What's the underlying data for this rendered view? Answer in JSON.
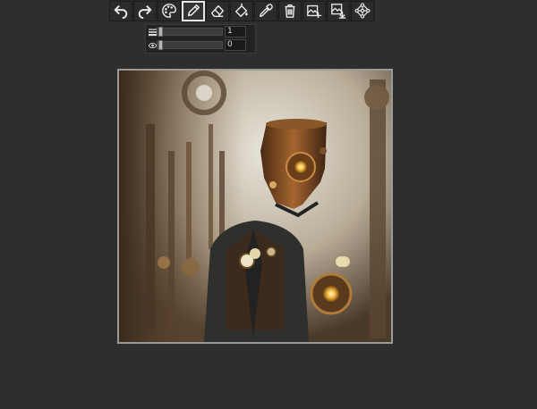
{
  "toolbar": {
    "tools": [
      {
        "name": "undo",
        "icon": "undo-icon"
      },
      {
        "name": "redo",
        "icon": "redo-icon"
      },
      {
        "name": "palette",
        "icon": "palette-icon"
      },
      {
        "name": "pencil",
        "icon": "pencil-icon",
        "active": true
      },
      {
        "name": "eraser",
        "icon": "eraser-icon"
      },
      {
        "name": "fill",
        "icon": "fill-icon"
      },
      {
        "name": "eyedropper",
        "icon": "eyedropper-icon"
      },
      {
        "name": "clear",
        "icon": "trash-icon"
      },
      {
        "name": "add-image",
        "icon": "image-add-icon"
      },
      {
        "name": "save-image",
        "icon": "image-download-icon"
      },
      {
        "name": "network",
        "icon": "network-icon"
      }
    ]
  },
  "sliders": {
    "brush_size": {
      "value": "1",
      "icon": "line-width-icon",
      "level": 0.02
    },
    "opacity": {
      "value": "0",
      "icon": "eye-icon",
      "level": 0.02
    }
  },
  "canvas": {
    "description_icon": "steampunk-figure-image",
    "colors": {
      "bg": "#d8d2c4",
      "bronze": "#7a4a22",
      "dark": "#2a2622"
    }
  }
}
